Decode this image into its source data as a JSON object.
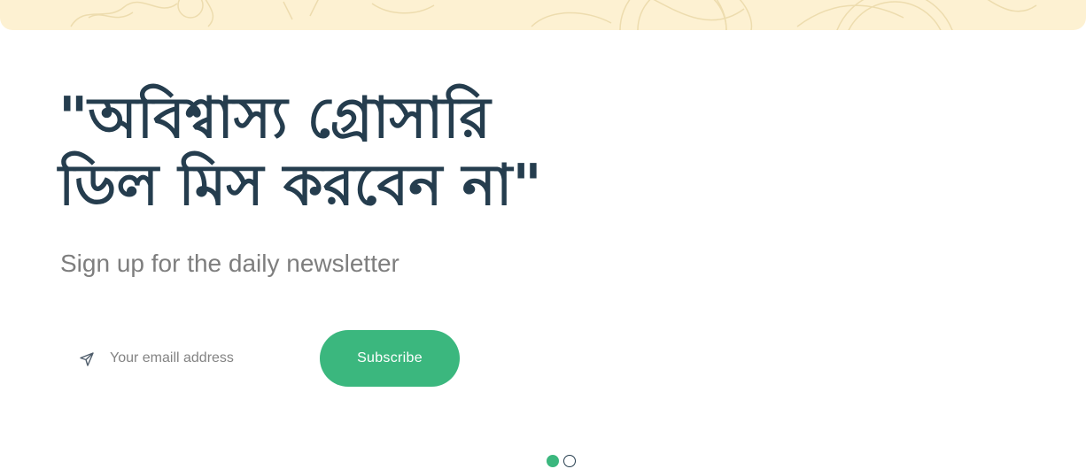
{
  "banner": {
    "background_color": "#fdf1d2",
    "decoration_color": "#eddcae"
  },
  "hero": {
    "headline_line1": "\"অবিশ্বাস্য গ্রোসারি",
    "headline_line2": "ডিল মিস করবেন না\"",
    "subtitle": "Sign up for the daily newsletter",
    "headline_color": "#253d4e",
    "subtitle_color": "#7e7e7e"
  },
  "newsletter": {
    "icon": "send-icon",
    "email_placeholder": "Your emaill address",
    "email_value": "",
    "subscribe_label": "Subscribe",
    "accent_color": "#3bb77e"
  },
  "slider": {
    "slide_count": 2,
    "active_index": 0
  }
}
